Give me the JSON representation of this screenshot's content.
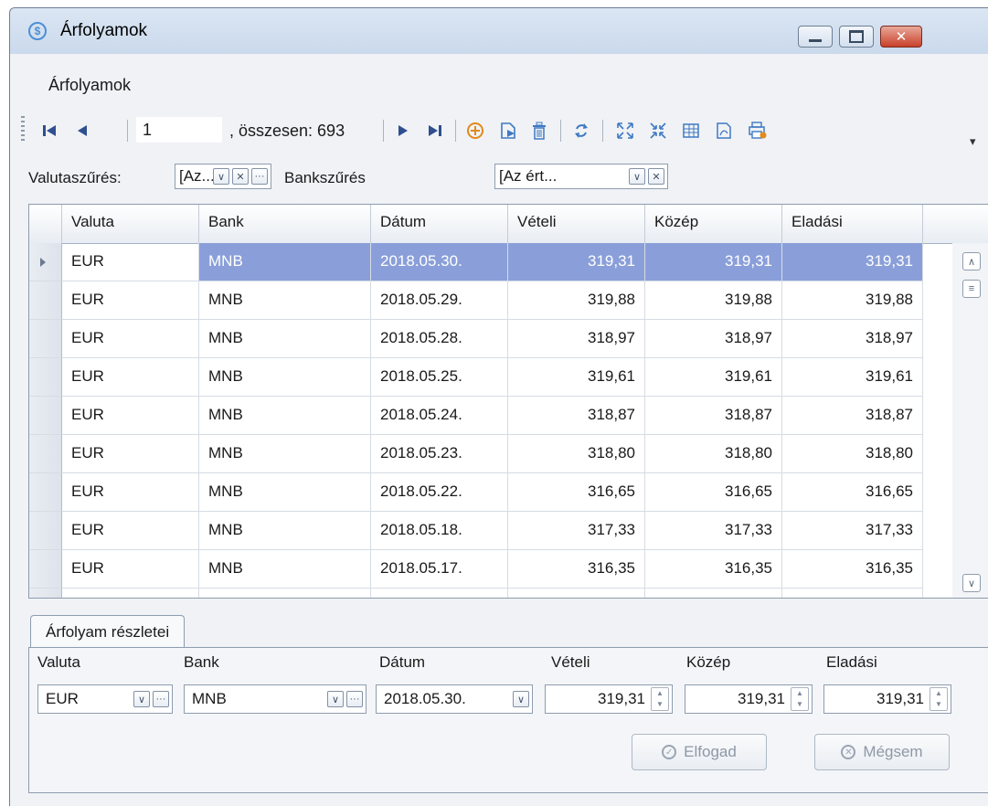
{
  "window": {
    "title": "Árfolyamok",
    "menu": [
      "Árfolyamok"
    ]
  },
  "toolbar": {
    "record_number": "1",
    "total_text": ", összesen: 693"
  },
  "filters": {
    "currency_label": "Valutaszűrés:",
    "currency_value": "[Az...",
    "bank_label": "Bankszűrés",
    "bank_value": "[Az ért..."
  },
  "grid": {
    "columns": [
      "Valuta",
      "Bank",
      "Dátum",
      "Vételi",
      "Közép",
      "Eladási"
    ],
    "rows": [
      [
        "EUR",
        "MNB",
        "2018.05.30.",
        "319,31",
        "319,31",
        "319,31"
      ],
      [
        "EUR",
        "MNB",
        "2018.05.29.",
        "319,88",
        "319,88",
        "319,88"
      ],
      [
        "EUR",
        "MNB",
        "2018.05.28.",
        "318,97",
        "318,97",
        "318,97"
      ],
      [
        "EUR",
        "MNB",
        "2018.05.25.",
        "319,61",
        "319,61",
        "319,61"
      ],
      [
        "EUR",
        "MNB",
        "2018.05.24.",
        "318,87",
        "318,87",
        "318,87"
      ],
      [
        "EUR",
        "MNB",
        "2018.05.23.",
        "318,80",
        "318,80",
        "318,80"
      ],
      [
        "EUR",
        "MNB",
        "2018.05.22.",
        "316,65",
        "316,65",
        "316,65"
      ],
      [
        "EUR",
        "MNB",
        "2018.05.18.",
        "317,33",
        "317,33",
        "317,33"
      ],
      [
        "EUR",
        "MNB",
        "2018.05.17.",
        "316,35",
        "316,35",
        "316,35"
      ]
    ],
    "selected_row": 0
  },
  "details": {
    "tab_label": "Árfolyam részletei",
    "labels": [
      "Valuta",
      "Bank",
      "Dátum",
      "Vételi",
      "Közép",
      "Eladási"
    ],
    "valuta": "EUR",
    "bank": "MNB",
    "datum": "2018.05.30.",
    "veteli": "319,31",
    "kozep": "319,31",
    "eladasi": "319,31",
    "accept_label": "Elfogad",
    "cancel_label": "Mégsem"
  },
  "colors": {
    "selection": "#8a9fd9",
    "toolbar_icon": "#2f4f8f",
    "add_icon": "#e28a1a"
  }
}
